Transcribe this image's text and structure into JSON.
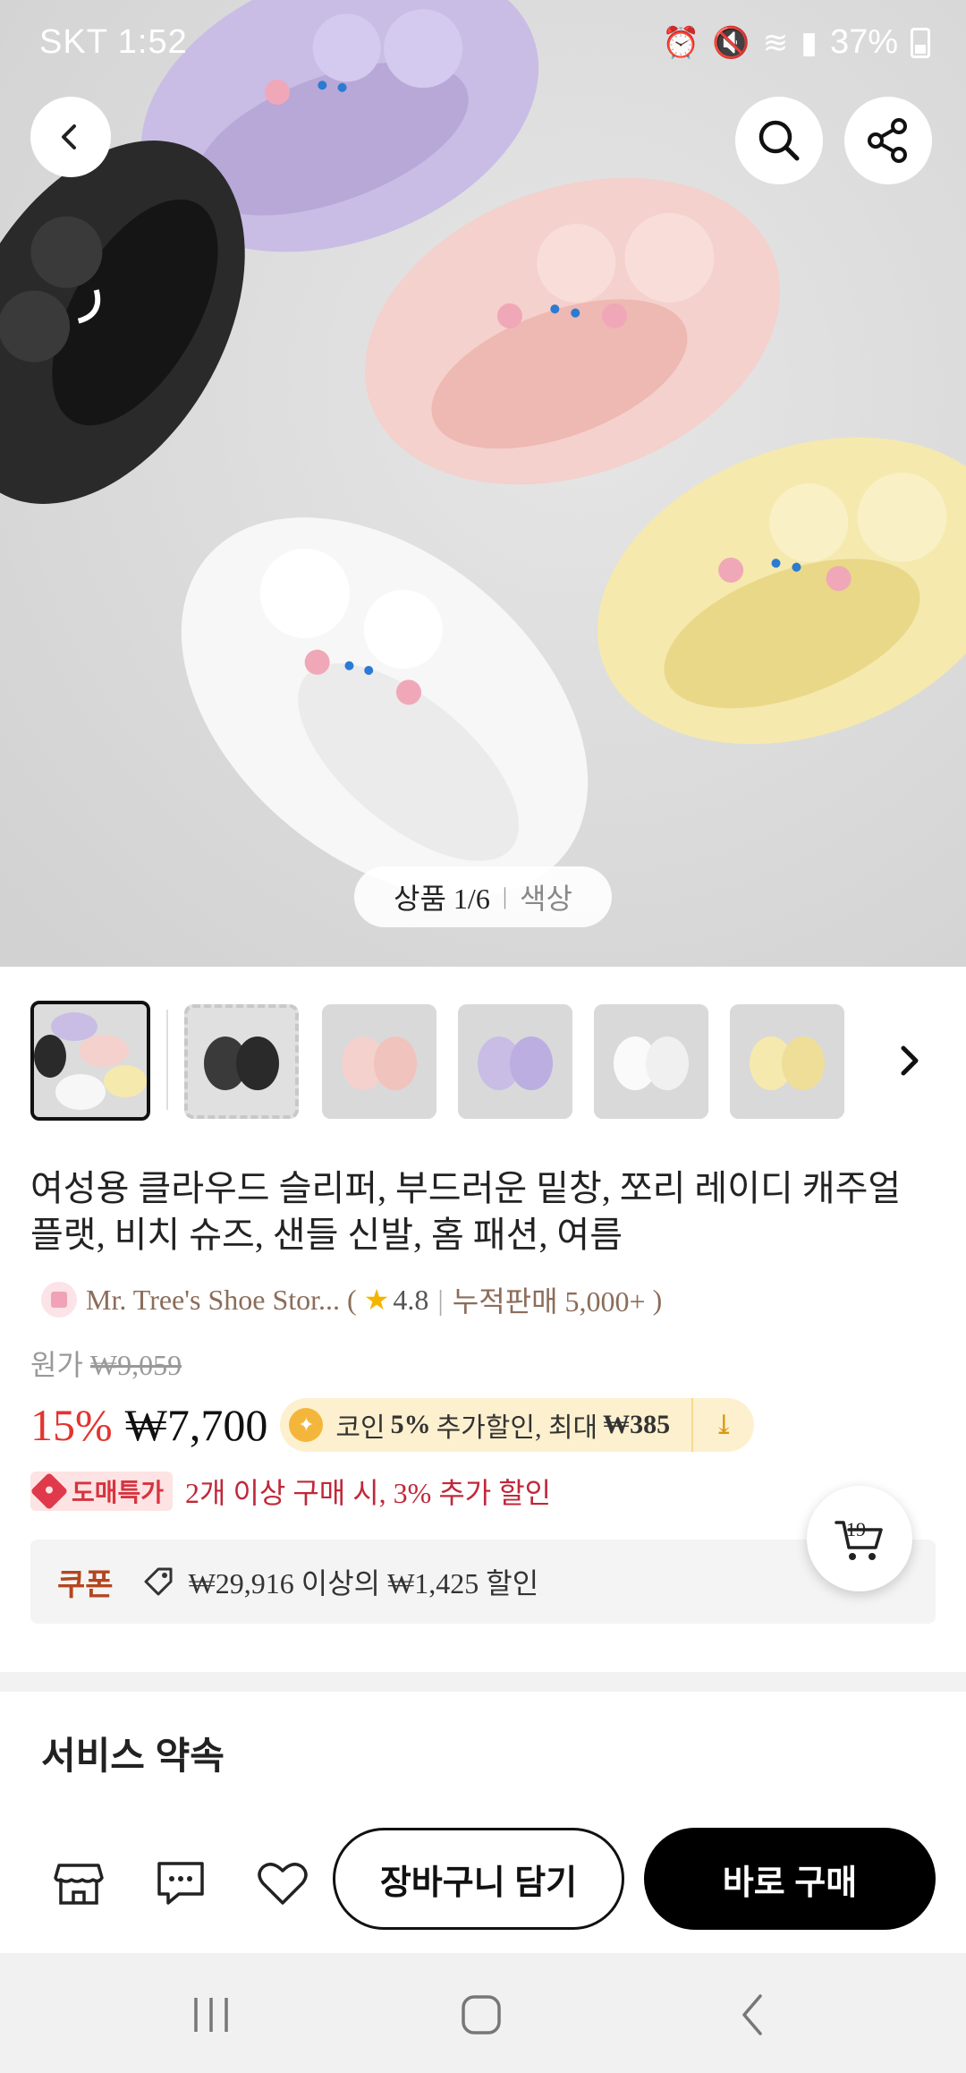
{
  "status_bar": {
    "carrier_time": "SKT 1:52",
    "battery": "37%"
  },
  "image_viewer": {
    "tab_product": "상품 1/6",
    "tab_color": "색상"
  },
  "product": {
    "title": "여성용 클라우드 슬리퍼, 부드러운 밑창, 쪼리 레이디 캐주얼 플랫, 비치 슈즈, 샌들 신발, 홈 패션, 여름",
    "store_name": "Mr. Tree's Shoe Stor...",
    "rating": "4.8",
    "sales": "누적판매 5,000+",
    "original_label": "원가",
    "original_price": "₩9,059",
    "discount": "15%",
    "price": "₩7,700",
    "coin_text_pre": "코인",
    "coin_percent": "5%",
    "coin_text_mid": "추가할인, 최대",
    "coin_max": "₩385",
    "wholesale_badge": "도매특가",
    "wholesale_text": "2개 이상 구매 시, 3% 추가 할인",
    "coupon_label": "쿠폰",
    "coupon_text": "₩29,916 이상의 ₩1,425 할인"
  },
  "cart_count": "19",
  "service_title": "서비스 약속",
  "actions": {
    "add_to_cart": "장바구니 담기",
    "buy_now": "바로 구매"
  },
  "thumbnails": [
    {
      "color": "mixed"
    },
    {
      "color": "black"
    },
    {
      "color": "pink"
    },
    {
      "color": "purple"
    },
    {
      "color": "white"
    },
    {
      "color": "yellow"
    }
  ]
}
